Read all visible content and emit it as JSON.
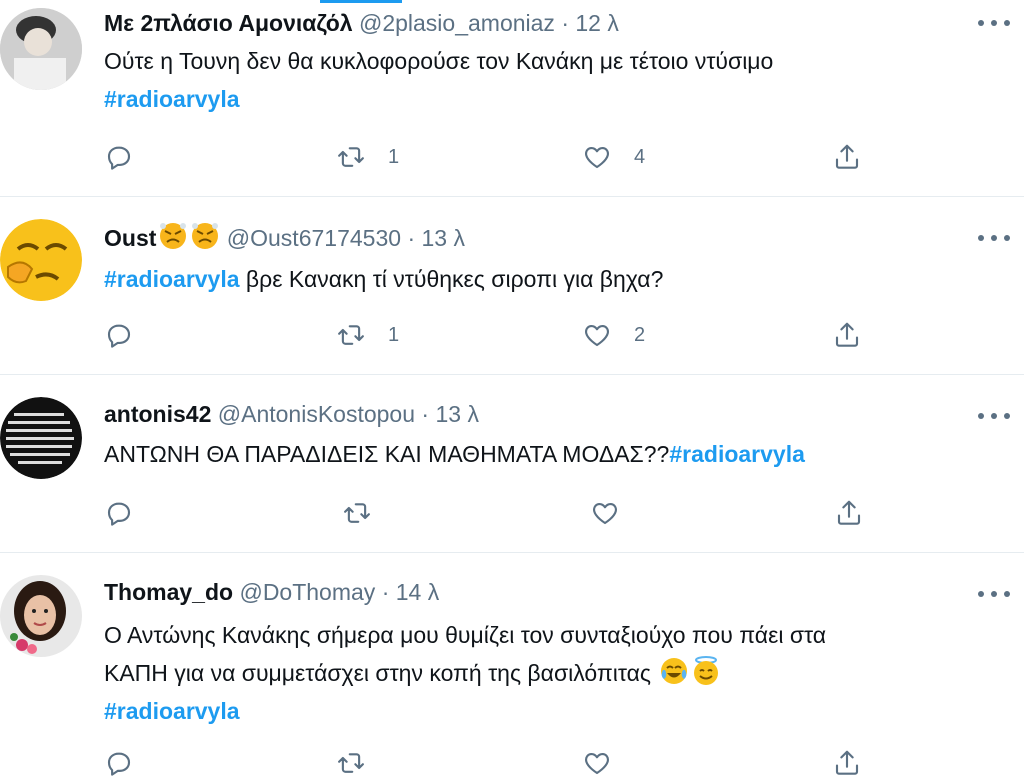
{
  "tweets": [
    {
      "name": "Με 2πλάσιο Αμονιαζόλ",
      "handle": "@2plasio_amoniaz",
      "dot": "·",
      "time": "12 λ",
      "text_line1": "Ούτε η Τουνη δεν θα κυκλοφορούσε τον Κανάκη με τέτοιο ντύσιμο",
      "hashtag": "#radioarvyla",
      "retweets": "1",
      "likes": "4"
    },
    {
      "name": "Oust",
      "handle": "@Oust67174530",
      "dot": "·",
      "time": "13 λ",
      "hashtag": "#radioarvyla",
      "text_after": " βρε Κανακη τί ντύθηκες σιροπι για βηχα?",
      "retweets": "1",
      "likes": "2"
    },
    {
      "name": "antonis42",
      "handle": "@AntonisKostopou",
      "dot": "·",
      "time": "13 λ",
      "text_before": "ΑΝΤΩΝΗ ΘΑ ΠΑΡΑΔΙΔΕΙΣ ΚΑΙ ΜΑΘΗΜΑΤΑ ΜΟΔΑΣ??",
      "hashtag": "#radioarvyla",
      "retweets": "",
      "likes": ""
    },
    {
      "name": "Thomay_do",
      "handle": "@DoThomay",
      "dot": "·",
      "time": "14 λ",
      "text_line1": "Ο Αντώνης Κανάκης σήμερα μου θυμίζει τον συνταξιούχο που πάει στα",
      "text_line2": "ΚΑΠΗ για να συμμετάσχει στην κοπή της βασιλόπιτας",
      "hashtag": "#radioarvyla"
    }
  ],
  "icons": [
    "reply-icon",
    "retweet-icon",
    "like-icon",
    "share-icon",
    "more-icon"
  ],
  "colors": {
    "accent": "#1d9bf0",
    "muted": "#5b7083",
    "text": "#0f1419",
    "divider": "#e6ecf0"
  }
}
